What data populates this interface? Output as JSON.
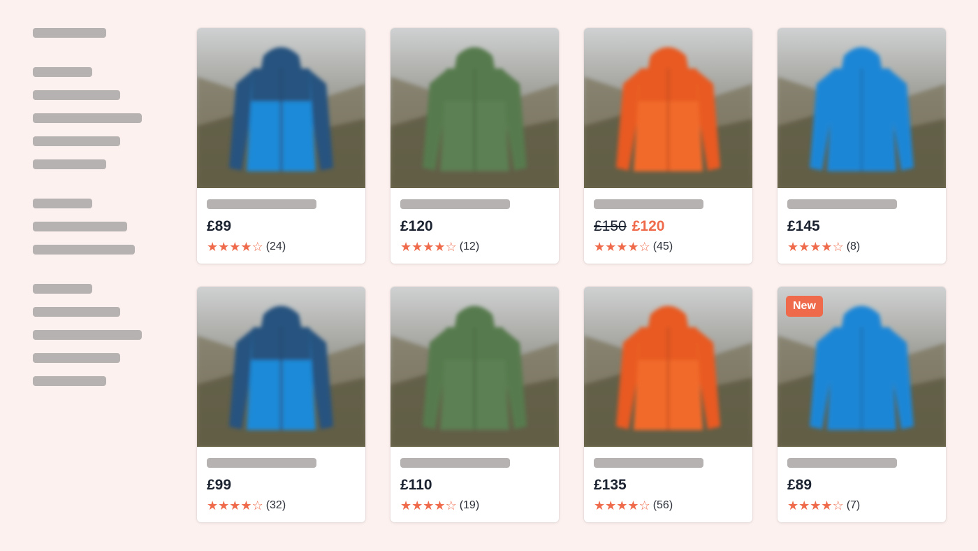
{
  "sidebar": {
    "groups": [
      {
        "kind": "heading"
      },
      {
        "kind": "list",
        "items": 5
      },
      {
        "kind": "list",
        "items": 3
      },
      {
        "kind": "list",
        "items": 5
      }
    ]
  },
  "products": [
    {
      "price": "£89",
      "old_price": "",
      "rating": 4,
      "reviews": "(24)",
      "badge": "",
      "jacket": "navy-blue"
    },
    {
      "price": "£120",
      "old_price": "",
      "rating": 4,
      "reviews": "(12)",
      "badge": "",
      "jacket": "green"
    },
    {
      "price": "£120",
      "old_price": "£150",
      "rating": 4,
      "reviews": "(45)",
      "badge": "",
      "jacket": "orange"
    },
    {
      "price": "£145",
      "old_price": "",
      "rating": 4,
      "reviews": "(8)",
      "badge": "",
      "jacket": "blue"
    },
    {
      "price": "£99",
      "old_price": "",
      "rating": 4,
      "reviews": "(32)",
      "badge": "",
      "jacket": "navy-blue"
    },
    {
      "price": "£110",
      "old_price": "",
      "rating": 4,
      "reviews": "(19)",
      "badge": "",
      "jacket": "green"
    },
    {
      "price": "£135",
      "old_price": "",
      "rating": 4,
      "reviews": "(56)",
      "badge": "",
      "jacket": "orange"
    },
    {
      "price": "£89",
      "old_price": "",
      "rating": 4,
      "reviews": "(7)",
      "badge": "New",
      "jacket": "blue"
    }
  ],
  "colors": {
    "accent": "#ef6a4a",
    "background": "#fcf1ef",
    "skeleton": "#b6b2b1",
    "price_text": "#1b2230"
  },
  "icons": {
    "star_full": "star-filled-icon",
    "star_empty": "star-outline-icon"
  }
}
